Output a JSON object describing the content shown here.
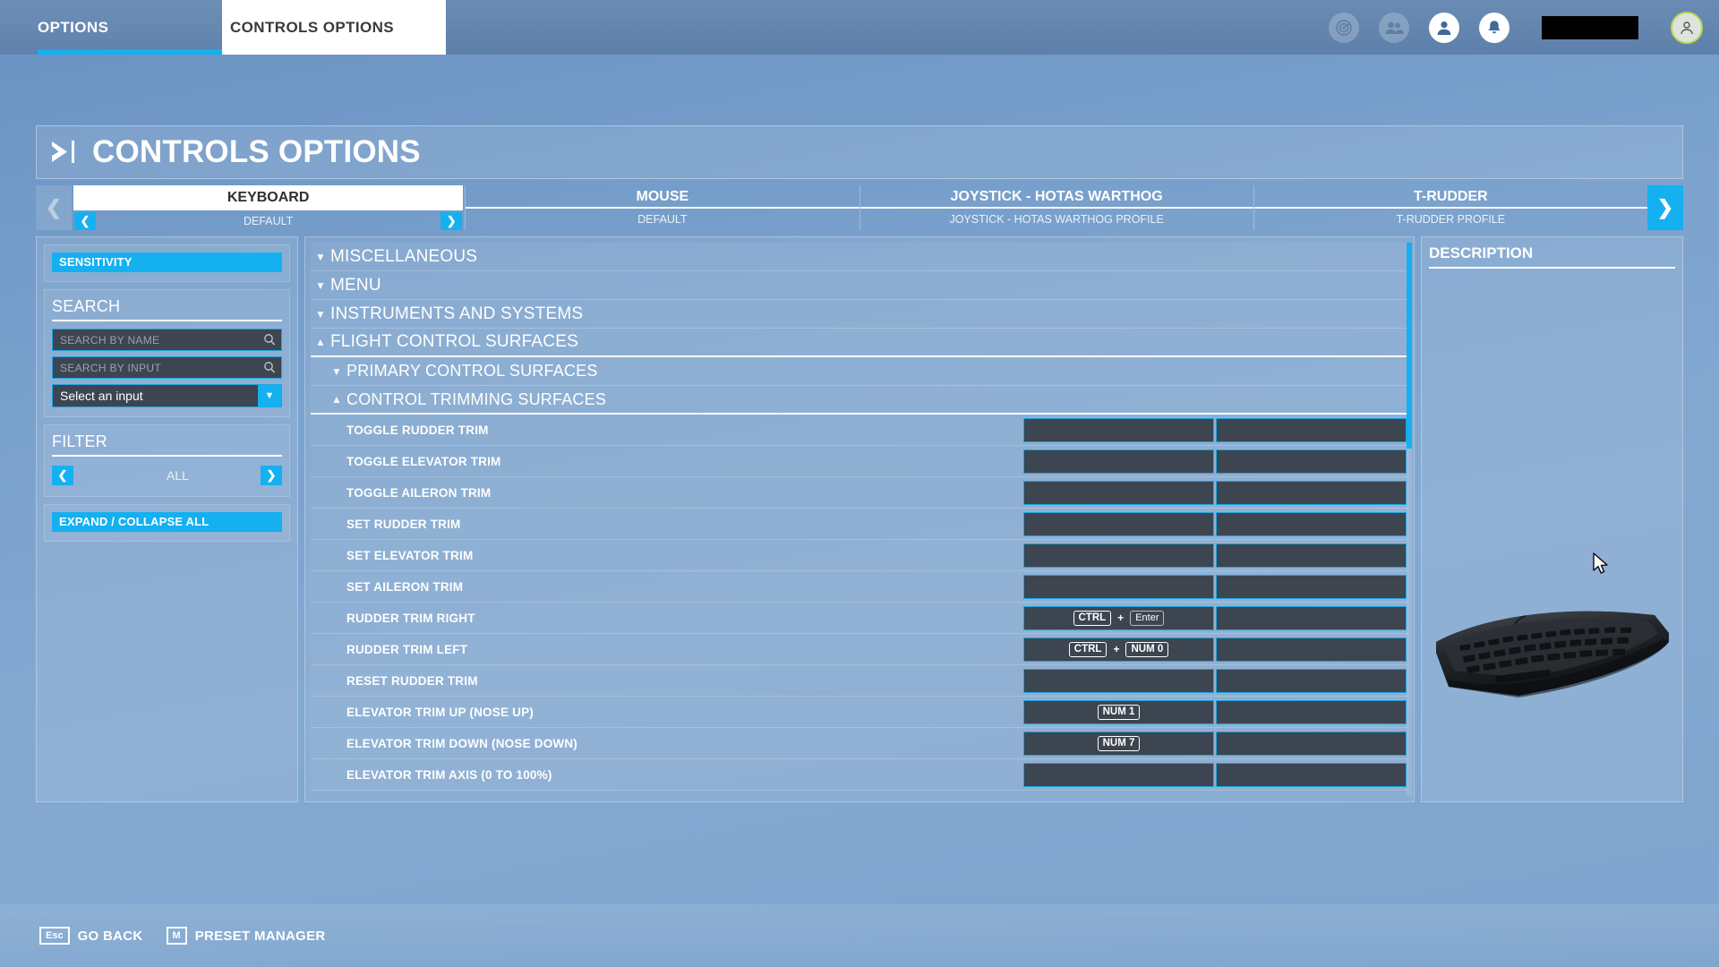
{
  "topbar": {
    "tabs": [
      {
        "label": "OPTIONS",
        "active": false
      },
      {
        "label": "CONTROLS OPTIONS",
        "active": true
      }
    ],
    "icons": [
      "radar-icon",
      "friends-icon",
      "profile-icon",
      "bell-icon"
    ],
    "username_redacted": "",
    "avatar": "avatar-icon"
  },
  "page": {
    "title": "CONTROLS OPTIONS",
    "caret_icon": "prompt-caret-icon"
  },
  "devices": {
    "prev_icon": "chevron-left-icon",
    "next_icon": "chevron-right-icon",
    "tabs": [
      {
        "name": "KEYBOARD",
        "profile": "DEFAULT",
        "selected": true
      },
      {
        "name": "MOUSE",
        "profile": "DEFAULT",
        "selected": false
      },
      {
        "name": "JOYSTICK - HOTAS WARTHOG",
        "profile": "JOYSTICK - HOTAS WARTHOG PROFILE",
        "selected": false
      },
      {
        "name": "T-RUDDER",
        "profile": "T-RUDDER PROFILE",
        "selected": false
      }
    ]
  },
  "sidebar": {
    "sensitivity_label": "SENSITIVITY",
    "search_label": "SEARCH",
    "search_name_placeholder": "SEARCH BY NAME",
    "search_name_value": "",
    "search_input_placeholder": "SEARCH BY INPUT",
    "search_input_value": "",
    "select_input_value": "Select an input",
    "filter_label": "FILTER",
    "filter_value": "ALL",
    "expand_collapse_label": "EXPAND / COLLAPSE ALL"
  },
  "description": {
    "header": "DESCRIPTION",
    "text": "",
    "device_image": "keyboard-image"
  },
  "list": {
    "categories": [
      {
        "label": "MISCELLANEOUS",
        "level": 1,
        "expanded": false
      },
      {
        "label": "MENU",
        "level": 1,
        "expanded": false
      },
      {
        "label": "INSTRUMENTS AND SYSTEMS",
        "level": 1,
        "expanded": false
      },
      {
        "label": "FLIGHT CONTROL SURFACES",
        "level": 1,
        "expanded": true
      },
      {
        "label": "PRIMARY CONTROL SURFACES",
        "level": 2,
        "expanded": false
      },
      {
        "label": "CONTROL TRIMMING SURFACES",
        "level": 2,
        "expanded": true
      }
    ],
    "rows": [
      {
        "label": "TOGGLE RUDDER TRIM",
        "primary": [],
        "secondary": []
      },
      {
        "label": "TOGGLE ELEVATOR TRIM",
        "primary": [],
        "secondary": []
      },
      {
        "label": "TOGGLE AILERON TRIM",
        "primary": [],
        "secondary": []
      },
      {
        "label": "SET RUDDER TRIM",
        "primary": [],
        "secondary": []
      },
      {
        "label": "SET ELEVATOR TRIM",
        "primary": [],
        "secondary": []
      },
      {
        "label": "SET AILERON TRIM",
        "primary": [],
        "secondary": []
      },
      {
        "label": "RUDDER TRIM RIGHT",
        "primary": [
          "CTRL",
          "+",
          "Enter"
        ],
        "secondary": []
      },
      {
        "label": "RUDDER TRIM LEFT",
        "primary": [
          "CTRL",
          "+",
          "NUM 0"
        ],
        "secondary": []
      },
      {
        "label": "RESET RUDDER TRIM",
        "primary": [],
        "secondary": []
      },
      {
        "label": "ELEVATOR TRIM UP (NOSE UP)",
        "primary": [
          "NUM 1"
        ],
        "secondary": []
      },
      {
        "label": "ELEVATOR TRIM DOWN (NOSE DOWN)",
        "primary": [
          "NUM 7"
        ],
        "secondary": []
      },
      {
        "label": "ELEVATOR TRIM AXIS (0 TO 100%)",
        "primary": [],
        "secondary": []
      }
    ]
  },
  "footer": {
    "actions": [
      {
        "key": "Esc",
        "label": "GO BACK"
      },
      {
        "key": "M",
        "label": "PRESET MANAGER"
      }
    ]
  },
  "colors": {
    "accent_cyan": "#15b0f0",
    "panel_blue": "#5d80aa",
    "field_dark": "#3c4550",
    "avatar_ring": "#b9d94a"
  }
}
